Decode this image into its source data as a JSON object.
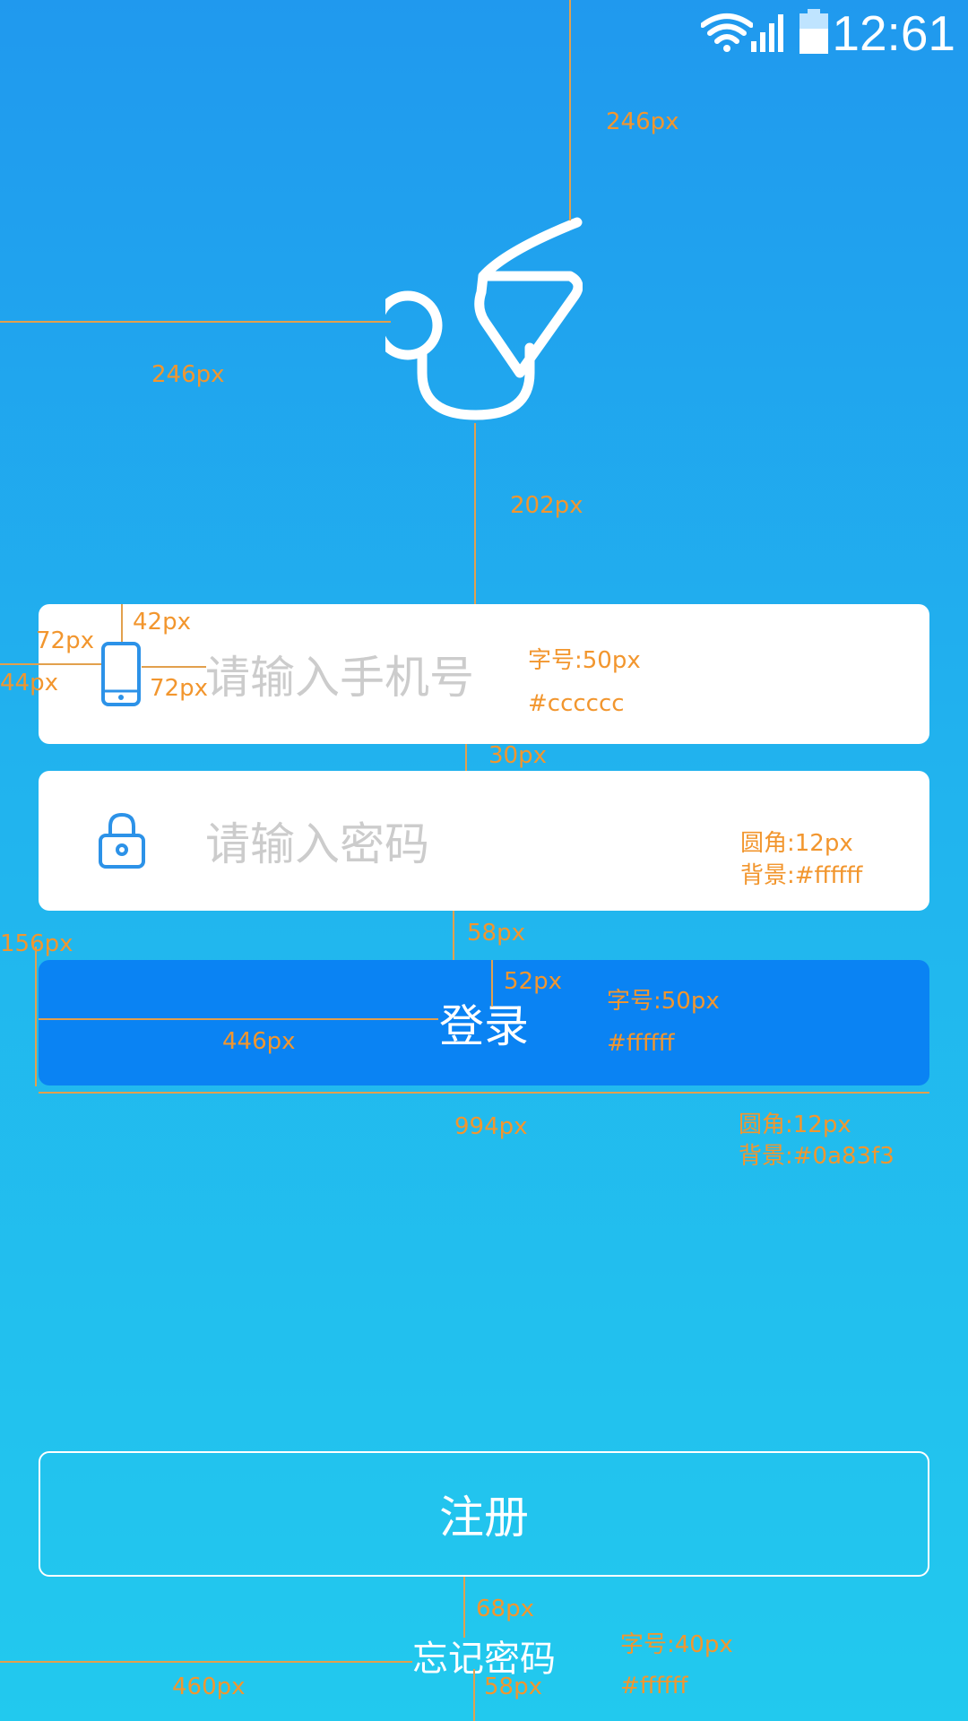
{
  "status_bar": {
    "time": "12:61",
    "icons": [
      "wifi-icon",
      "cell-signal-icon",
      "battery-icon"
    ]
  },
  "logo": {
    "icon": "stethoscope-icon"
  },
  "phone_field": {
    "placeholder": "请输入手机号",
    "icon": "mobile-phone-icon"
  },
  "password_field": {
    "placeholder": "请输入密码",
    "icon": "lock-icon"
  },
  "login_button": {
    "label": "登录"
  },
  "register_button": {
    "label": "注册"
  },
  "forgot_password": {
    "label": "忘记密码"
  },
  "colors": {
    "background_top": "#2099ee",
    "background_bottom": "#22c9ee",
    "login_button": "#0a83f3",
    "placeholder": "#cccccc",
    "white": "#ffffff",
    "annotation": "#f2962e"
  },
  "annotations": {
    "a1": "246px",
    "a2": "246px",
    "a3": "202px",
    "a4": "42px",
    "a5": "72px",
    "a6": "44px",
    "a7": "72px",
    "a8": "字号:50px",
    "a9": "#cccccc",
    "a10": "30px",
    "a11": "圆角:12px",
    "a12": "背景:#ffffff",
    "a13": "156px",
    "a14": "58px",
    "a15": "52px",
    "a16": "字号:50px",
    "a17": "#ffffff",
    "a18": "446px",
    "a19": "994px",
    "a20": "圆角:12px",
    "a21": "背景:#0a83f3",
    "a22": "68px",
    "a23": "字号:40px",
    "a24": "#ffffff",
    "a25": "460px",
    "a26": "58px"
  }
}
